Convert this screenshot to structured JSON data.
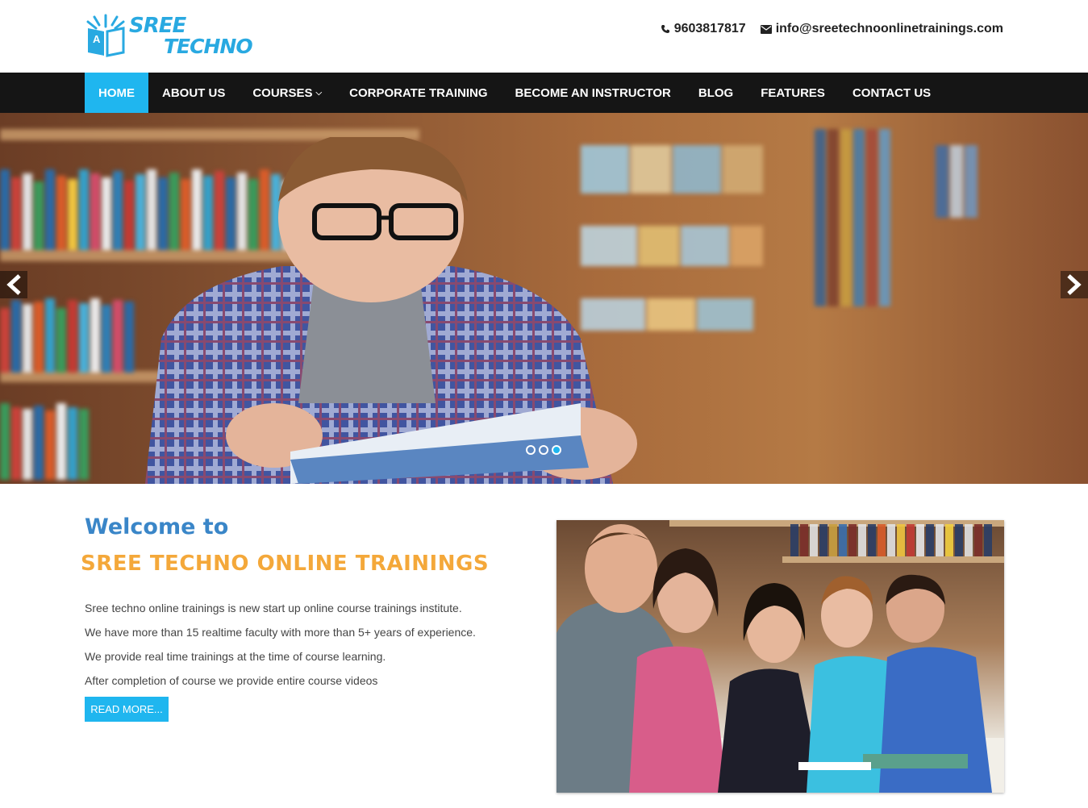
{
  "header": {
    "logo_line1": "SREE",
    "logo_line2": "TECHNO",
    "logo_badge": "A",
    "phone": "9603817817",
    "email": "info@sreetechnoonlinetrainings.com"
  },
  "nav": {
    "items": [
      {
        "label": "HOME",
        "active": true
      },
      {
        "label": "ABOUT US"
      },
      {
        "label": "COURSES",
        "dropdown": true
      },
      {
        "label": "CORPORATE TRAINING"
      },
      {
        "label": "BECOME AN INSTRUCTOR"
      },
      {
        "label": "BLOG"
      },
      {
        "label": "FEATURES"
      },
      {
        "label": "CONTACT US"
      }
    ]
  },
  "hero": {
    "image": "student reading book in library",
    "slides": 3,
    "active_slide": 3
  },
  "welcome": {
    "title": "Welcome to",
    "company": "SREE TECHNO ONLINE TRAININGS",
    "paragraphs": [
      "Sree techno online trainings is new start up online course trainings institute.",
      "We have more than 15 realtime faculty with more than 5+ years of experience.",
      "We provide real time trainings at the time of course learning.",
      "After completion of course we provide entire course videos"
    ],
    "button": "READ MORE...",
    "image": "group of smiling students in library"
  },
  "colors": {
    "accent": "#1fb6ef",
    "nav_bg": "#151515",
    "title_blue": "#3a86c8",
    "company_orange": "#f4a83a"
  }
}
